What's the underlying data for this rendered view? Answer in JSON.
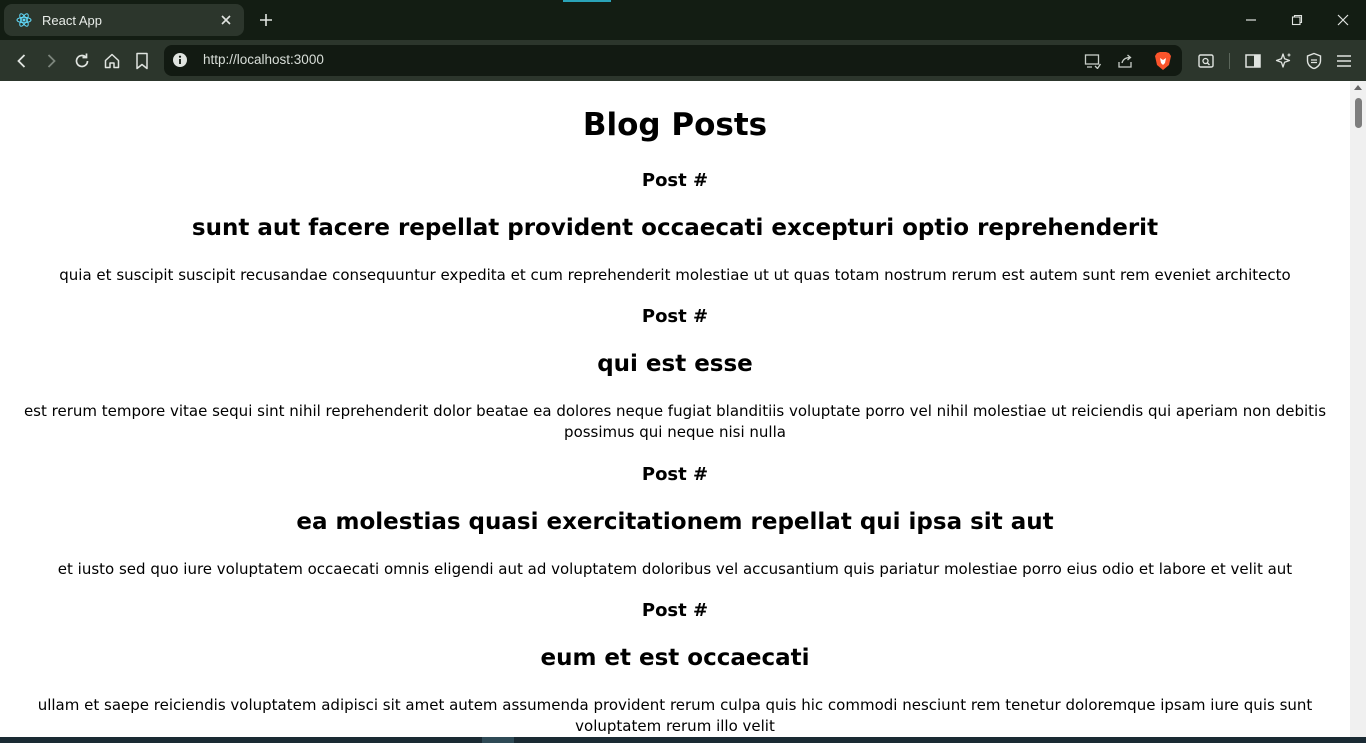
{
  "browser": {
    "tab": {
      "title": "React App"
    },
    "address_bar": {
      "url": "http://localhost:3000"
    }
  },
  "page": {
    "heading": "Blog Posts",
    "posts": [
      {
        "label": "Post #",
        "title": "sunt aut facere repellat provident occaecati excepturi optio reprehenderit",
        "body": "quia et suscipit suscipit recusandae consequuntur expedita et cum reprehenderit molestiae ut ut quas totam nostrum rerum est autem sunt rem eveniet architecto"
      },
      {
        "label": "Post #",
        "title": "qui est esse",
        "body": "est rerum tempore vitae sequi sint nihil reprehenderit dolor beatae ea dolores neque fugiat blanditiis voluptate porro vel nihil molestiae ut reiciendis qui aperiam non debitis possimus qui neque nisi nulla"
      },
      {
        "label": "Post #",
        "title": "ea molestias quasi exercitationem repellat qui ipsa sit aut",
        "body": "et iusto sed quo iure voluptatem occaecati omnis eligendi aut ad voluptatem doloribus vel accusantium quis pariatur molestiae porro eius odio et labore et velit aut"
      },
      {
        "label": "Post #",
        "title": "eum et est occaecati",
        "body": "ullam et saepe reiciendis voluptatem adipisci sit amet autem assumenda provident rerum culpa quis hic commodi nesciunt rem tenetur doloremque ipsam iure quis sunt voluptatem rerum illo velit"
      }
    ]
  },
  "icons": {
    "tab_favicon": "react-logo-icon",
    "tab_close": "close-icon",
    "new_tab": "plus-icon",
    "back": "back-arrow-icon",
    "forward": "forward-arrow-icon",
    "reload": "reload-icon",
    "home": "home-icon",
    "bookmark": "bookmark-icon",
    "site_info": "info-icon",
    "cast": "cast-icon",
    "share": "share-icon",
    "brave_shields": "brave-lion-icon",
    "reader": "reader-mode-icon",
    "sidebar": "sidebar-icon",
    "leo": "leo-ai-icon",
    "vpn": "vpn-shield-icon",
    "menu": "hamburger-menu-icon"
  },
  "colors": {
    "chrome_dark": "#131d13",
    "toolbar": "#2c362c",
    "omnibox": "#121a12",
    "brave_orange": "#fb542b",
    "react_blue": "#61dafb",
    "page_bg": "#ffffff",
    "text": "#000000"
  }
}
